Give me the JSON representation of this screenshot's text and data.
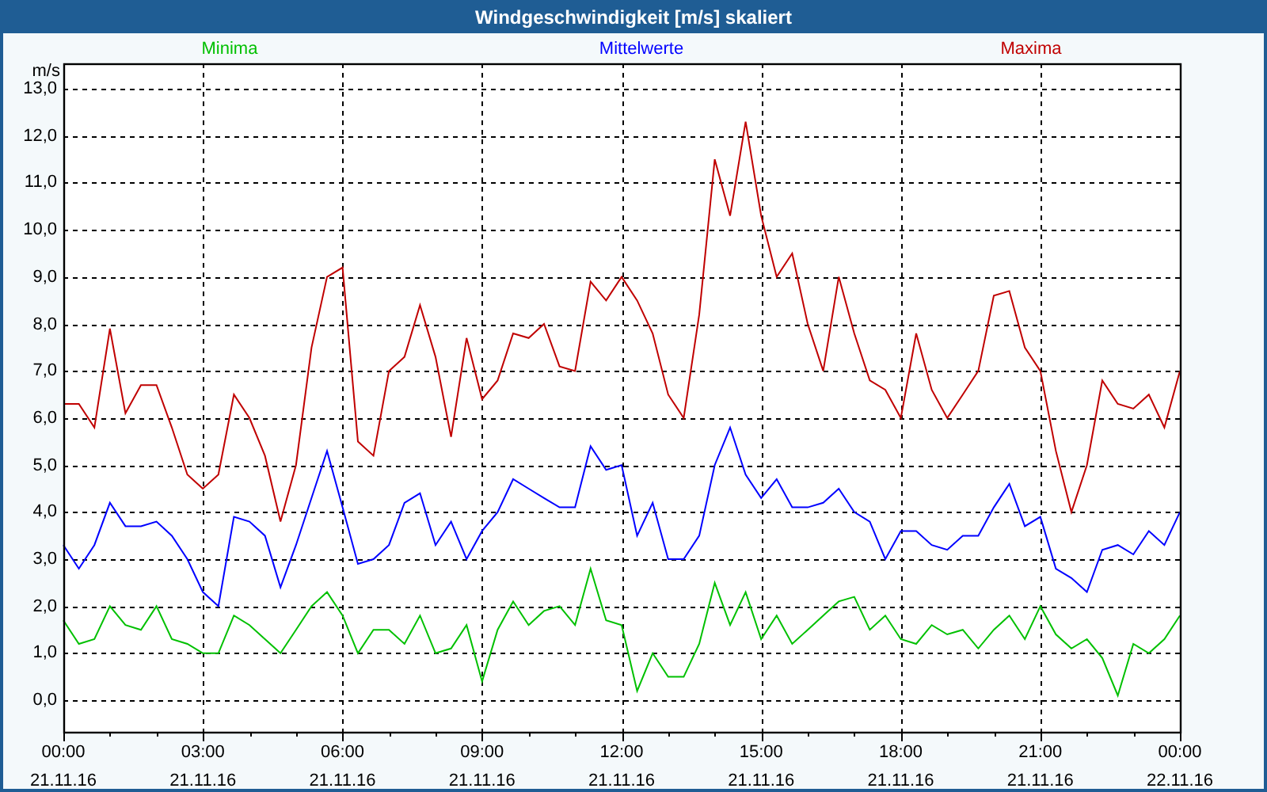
{
  "window": {
    "title": "Windgeschwindigkeit [m/s] skaliert"
  },
  "chart": {
    "chart_data": {
      "type": "line",
      "ylabel": "m/s",
      "grid": true,
      "ylim": [
        -0.67,
        13.54
      ],
      "yticks": [
        {
          "value": 0,
          "label": "0,0"
        },
        {
          "value": 1,
          "label": "1,0"
        },
        {
          "value": 2,
          "label": "2,0"
        },
        {
          "value": 3,
          "label": "3,0"
        },
        {
          "value": 4,
          "label": "4,0"
        },
        {
          "value": 5,
          "label": "5,0"
        },
        {
          "value": 6,
          "label": "6,0"
        },
        {
          "value": 7,
          "label": "7,0"
        },
        {
          "value": 8,
          "label": "8,0"
        },
        {
          "value": 9,
          "label": "9,0"
        },
        {
          "value": 10,
          "label": "10,0"
        },
        {
          "value": 11,
          "label": "11,0"
        },
        {
          "value": 12,
          "label": "12,0"
        },
        {
          "value": 13,
          "label": "13,0"
        }
      ],
      "categories": [
        "00:00\n21.11.16",
        null,
        null,
        null,
        null,
        null,
        null,
        null,
        null,
        "03:00\n21.11.16",
        null,
        null,
        null,
        null,
        null,
        null,
        null,
        null,
        "06:00\n21.11.16",
        null,
        null,
        null,
        null,
        null,
        null,
        null,
        null,
        "09:00\n21.11.16",
        null,
        null,
        null,
        null,
        null,
        null,
        null,
        null,
        "12:00\n21.11.16",
        null,
        null,
        null,
        null,
        null,
        null,
        null,
        null,
        "15:00\n21.11.16",
        null,
        null,
        null,
        null,
        null,
        null,
        null,
        null,
        "18:00\n21.11.16",
        null,
        null,
        null,
        null,
        null,
        null,
        null,
        null,
        "21:00\n21.11.16",
        null,
        null,
        null,
        null,
        null,
        null,
        null,
        null,
        "00:00\n22.11.16"
      ],
      "series": [
        {
          "name": "Minima",
          "color": "#00c000",
          "values": [
            1.7,
            1.2,
            1.3,
            2.0,
            1.6,
            1.5,
            2.0,
            1.3,
            1.2,
            1.0,
            1.0,
            1.8,
            1.6,
            1.3,
            1.0,
            1.5,
            2.0,
            2.3,
            1.8,
            1.0,
            1.5,
            1.5,
            1.2,
            1.8,
            1.0,
            1.1,
            1.6,
            0.4,
            1.5,
            2.1,
            1.6,
            1.9,
            2.0,
            1.6,
            2.8,
            1.7,
            1.6,
            0.2,
            1.0,
            0.5,
            0.5,
            1.2,
            2.5,
            1.6,
            2.3,
            1.3,
            1.8,
            1.2,
            1.5,
            1.8,
            2.1,
            2.2,
            1.5,
            1.8,
            1.3,
            1.2,
            1.6,
            1.4,
            1.5,
            1.1,
            1.5,
            1.8,
            1.3,
            2.0,
            1.4,
            1.1,
            1.3,
            0.9,
            0.1,
            1.2,
            1.0,
            1.3,
            1.8
          ]
        },
        {
          "name": "Mittelwerte",
          "color": "#0000ff",
          "values": [
            3.3,
            2.8,
            3.3,
            4.2,
            3.7,
            3.7,
            3.8,
            3.5,
            3.0,
            2.3,
            2.0,
            3.9,
            3.8,
            3.5,
            2.4,
            3.3,
            4.3,
            5.3,
            4.1,
            2.9,
            3.0,
            3.3,
            4.2,
            4.4,
            3.3,
            3.8,
            3.0,
            3.6,
            4.0,
            4.7,
            4.5,
            4.3,
            4.1,
            4.1,
            5.4,
            4.9,
            5.0,
            3.5,
            4.2,
            3.0,
            3.0,
            3.5,
            5.0,
            5.8,
            4.8,
            4.3,
            4.7,
            4.1,
            4.1,
            4.2,
            4.5,
            4.0,
            3.8,
            3.0,
            3.6,
            3.6,
            3.3,
            3.2,
            3.5,
            3.5,
            4.1,
            4.6,
            3.7,
            3.9,
            2.8,
            2.6,
            2.3,
            3.2,
            3.3,
            3.1,
            3.6,
            3.3,
            4.0
          ]
        },
        {
          "name": "Maxima",
          "color": "#c00000",
          "values": [
            6.3,
            6.3,
            5.8,
            7.9,
            6.1,
            6.7,
            6.7,
            5.8,
            4.8,
            4.5,
            4.8,
            6.5,
            6.0,
            5.2,
            3.8,
            5.0,
            7.5,
            9.0,
            9.2,
            5.5,
            5.2,
            7.0,
            7.3,
            8.4,
            7.3,
            5.6,
            7.7,
            6.4,
            6.8,
            7.8,
            7.7,
            8.0,
            7.1,
            7.0,
            8.9,
            8.5,
            9.0,
            8.5,
            7.8,
            6.5,
            6.0,
            8.2,
            11.5,
            10.3,
            12.3,
            10.3,
            9.0,
            9.5,
            8.0,
            7.0,
            9.0,
            7.8,
            6.8,
            6.6,
            6.0,
            7.8,
            6.6,
            6.0,
            6.5,
            7.0,
            8.6,
            8.7,
            7.5,
            7.0,
            5.3,
            4.0,
            5.0,
            6.8,
            6.3,
            6.2,
            6.5,
            5.8,
            7.0
          ]
        }
      ]
    }
  }
}
